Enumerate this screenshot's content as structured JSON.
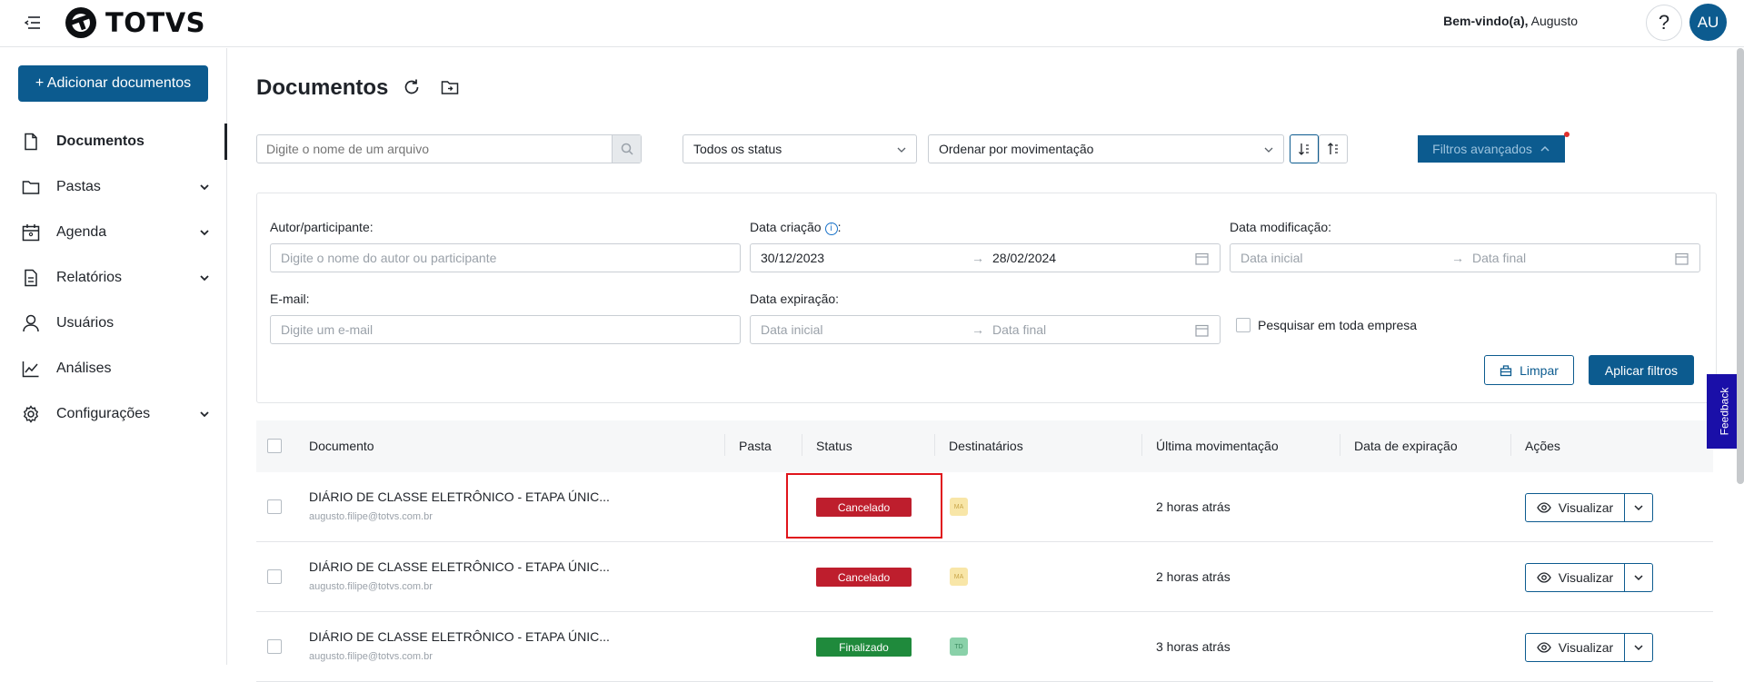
{
  "header": {
    "logo_text": "TOTVS",
    "welcome_bold": "Bem-vindo(a),",
    "welcome_name": "Augusto",
    "help_label": "?",
    "avatar_initials": "AU"
  },
  "sidebar": {
    "add_button": "+ Adicionar documentos",
    "items": [
      {
        "label": "Documentos",
        "icon": "document-icon",
        "active": true
      },
      {
        "label": "Pastas",
        "icon": "folder-icon",
        "expandable": true
      },
      {
        "label": "Agenda",
        "icon": "calendar-icon",
        "expandable": true
      },
      {
        "label": "Relatórios",
        "icon": "report-icon",
        "expandable": true
      },
      {
        "label": "Usuários",
        "icon": "user-icon"
      },
      {
        "label": "Análises",
        "icon": "chart-line-icon"
      },
      {
        "label": "Configurações",
        "icon": "gear-icon",
        "expandable": true
      }
    ]
  },
  "toolbar": {
    "title": "Documentos",
    "search_placeholder": "Digite o nome de um arquivo",
    "status_select": "Todos os status",
    "order_select": "Ordenar por movimentação",
    "advanced_filters": "Filtros avançados"
  },
  "filters": {
    "author_label": "Autor/participante:",
    "author_placeholder": "Digite o nome do autor ou participante",
    "created_label": "Data criação",
    "created_start": "30/12/2023",
    "created_end": "28/02/2024",
    "modified_label": "Data modificação:",
    "modified_start_placeholder": "Data inicial",
    "modified_end_placeholder": "Data final",
    "email_label": "E-mail:",
    "email_placeholder": "Digite um e-mail",
    "expiration_label": "Data expiração:",
    "expiration_start_placeholder": "Data inicial",
    "expiration_end_placeholder": "Data final",
    "whole_company_label": "Pesquisar em toda empresa",
    "clear_button": "Limpar",
    "apply_button": "Aplicar filtros"
  },
  "table": {
    "columns": [
      "Documento",
      "Pasta",
      "Status",
      "Destinatários",
      "Última movimentação",
      "Data de expiração",
      "Ações"
    ],
    "rows": [
      {
        "name": "DIÁRIO DE CLASSE ELETRÔNICO - ETAPA ÚNIC...",
        "email": "augusto.filipe@totvs.com.br",
        "status": "Cancelado",
        "status_type": "cancel",
        "recipient": "MA",
        "recipient_color": "yellow",
        "last_movement": "2 horas atrás",
        "action": "Visualizar"
      },
      {
        "name": "DIÁRIO DE CLASSE ELETRÔNICO - ETAPA ÚNIC...",
        "email": "augusto.filipe@totvs.com.br",
        "status": "Cancelado",
        "status_type": "cancel",
        "recipient": "MA",
        "recipient_color": "yellow",
        "last_movement": "2 horas atrás",
        "action": "Visualizar"
      },
      {
        "name": "DIÁRIO DE CLASSE ELETRÔNICO - ETAPA ÚNIC...",
        "email": "augusto.filipe@totvs.com.br",
        "status": "Finalizado",
        "status_type": "done",
        "recipient": "TD",
        "recipient_color": "green",
        "last_movement": "3 horas atrás",
        "action": "Visualizar"
      }
    ]
  },
  "feedback_label": "Feedback",
  "colors": {
    "primary": "#0c5b8f",
    "cancel": "#be1e2d",
    "done": "#1f8a3c",
    "highlight": "#e0141b",
    "feedback": "#1a0fa8"
  }
}
